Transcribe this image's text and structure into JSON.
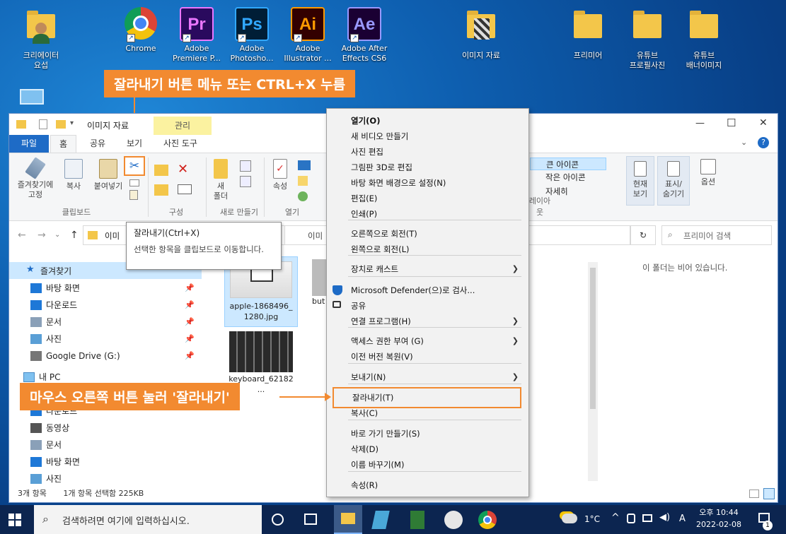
{
  "desktop": {
    "icons": [
      {
        "label": "크리에이터\n요섭",
        "icon": "person-folder-icon"
      },
      {
        "label": "Chrome",
        "icon": "chrome-icon"
      },
      {
        "label": "Adobe\nPremiere P...",
        "icon": "premiere-icon",
        "abbr": "Pr",
        "bg": "#2a0a5e",
        "fg": "#ea77ff"
      },
      {
        "label": "Adobe\nPhotosho...",
        "icon": "photoshop-icon",
        "abbr": "Ps",
        "bg": "#001e36",
        "fg": "#31a8ff"
      },
      {
        "label": "Adobe\nIllustrator ...",
        "icon": "illustrator-icon",
        "abbr": "Ai",
        "bg": "#330000",
        "fg": "#ff9a00"
      },
      {
        "label": "Adobe After\nEffects CS6",
        "icon": "after-effects-icon",
        "abbr": "Ae",
        "bg": "#1a0033",
        "fg": "#9999ff"
      },
      {
        "label": "이미지 자료",
        "icon": "image-folder-icon"
      },
      {
        "label": "프리미어",
        "icon": "folder-icon"
      },
      {
        "label": "유튜브\n프로필사진",
        "icon": "folder-icon"
      },
      {
        "label": "유튜브\n배너이미지",
        "icon": "folder-icon"
      }
    ]
  },
  "callouts": {
    "top": "잘라내기 버튼 메뉴 또는 CTRL+X 누름",
    "bottom": "마우스 오른쪽 버튼 눌러 '잘라내기'"
  },
  "explorer": {
    "title": "이미지 자료",
    "contextual_tab_group": "관리",
    "tabs": [
      "파일",
      "홈",
      "공유",
      "보기",
      "사진 도구"
    ],
    "window_controls": [
      "—",
      "☐",
      "✕"
    ],
    "ribbon": {
      "clipboard_buttons": [
        "즐겨찾기에\n고정",
        "복사",
        "붙여넣기"
      ],
      "groups": [
        "클립보드",
        "구성",
        "새로 만들기",
        "열기"
      ],
      "new_folder": "새\n폴더",
      "properties": "속성",
      "layout_items": [
        "큰 아이콘",
        "작은 아이콘",
        "자세히"
      ],
      "layout_group": "레이아웃",
      "view_buttons": [
        "현재\n보기",
        "표시/\n숨기기",
        "옵션"
      ]
    },
    "tooltip": {
      "title": "잘라내기(Ctrl+X)",
      "body": "선택한 항목을 클립보드로 이동합니다."
    },
    "address_prefix": "이미",
    "address_right": "이미",
    "search_placeholder": "프리미어 검색",
    "empty_message": "이 폴더는 비어 있습니다.",
    "nav_quick_access": "즐겨찾기",
    "nav_items": [
      {
        "label": "바탕 화면",
        "icon": "desktop-icon",
        "color": "#1e78d7"
      },
      {
        "label": "다운로드",
        "icon": "download-icon",
        "color": "#1e78d7"
      },
      {
        "label": "문서",
        "icon": "document-icon",
        "color": "#8aa0b8"
      },
      {
        "label": "사진",
        "icon": "pictures-icon",
        "color": "#5a9fd6"
      },
      {
        "label": "Google Drive (G:)",
        "icon": "drive-icon",
        "color": "#777"
      }
    ],
    "nav_pc": "내 PC",
    "nav_pc_items": [
      {
        "label": "다운로드",
        "icon": "download-icon",
        "color": "#1e78d7"
      },
      {
        "label": "동영상",
        "icon": "video-icon",
        "color": "#555"
      },
      {
        "label": "문서",
        "icon": "document-icon",
        "color": "#8aa0b8"
      },
      {
        "label": "바탕 화면",
        "icon": "desktop-icon",
        "color": "#1e78d7"
      },
      {
        "label": "사진",
        "icon": "pictures-icon",
        "color": "#5a9fd6"
      }
    ],
    "files": [
      {
        "name": "apple-1868496_\n1280.jpg",
        "selected": true
      },
      {
        "name": "but",
        "selected": false
      },
      {
        "name": "keyboard_62182\n...",
        "selected": false
      }
    ],
    "status_count": "3개 항목",
    "status_selected": "1개 항목 선택함 225KB"
  },
  "context_menu": {
    "items": [
      {
        "label": "열기(O)",
        "bold": true
      },
      {
        "label": "새 비디오 만들기"
      },
      {
        "label": "사진 편집"
      },
      {
        "label": "그림판 3D로 편집"
      },
      {
        "label": "바탕 화면 배경으로 설정(N)"
      },
      {
        "label": "편집(E)"
      },
      {
        "label": "인쇄(P)"
      },
      {
        "label": "오른쪽으로 회전(T)"
      },
      {
        "label": "왼쪽으로 회전(L)"
      },
      {
        "label": "장치로 캐스트",
        "submenu": true
      },
      {
        "label": "Microsoft Defender(으)로 검사...",
        "icon": "defender-icon"
      },
      {
        "label": "공유",
        "icon": "share-icon"
      },
      {
        "label": "연결 프로그램(H)",
        "submenu": true
      },
      {
        "label": "액세스 권한 부여 (G)",
        "submenu": true
      },
      {
        "label": "이전 버전 복원(V)"
      },
      {
        "label": "보내기(N)",
        "submenu": true
      },
      {
        "label": "잘라내기(T)",
        "highlight": true
      },
      {
        "label": "복사(C)"
      },
      {
        "label": "바로 가기 만들기(S)"
      },
      {
        "label": "삭제(D)"
      },
      {
        "label": "이름 바꾸기(M)"
      },
      {
        "label": "속성(R)"
      }
    ]
  },
  "taskbar": {
    "search_placeholder": "검색하려면 여기에 입력하십시오.",
    "weather": "1°C",
    "ime": "A",
    "time": "오후 10:44",
    "date": "2022-02-08",
    "notification_count": "1"
  },
  "colors": {
    "callout": "#f28a30",
    "accent": "#1e6bc6",
    "selection": "#cce8ff"
  }
}
